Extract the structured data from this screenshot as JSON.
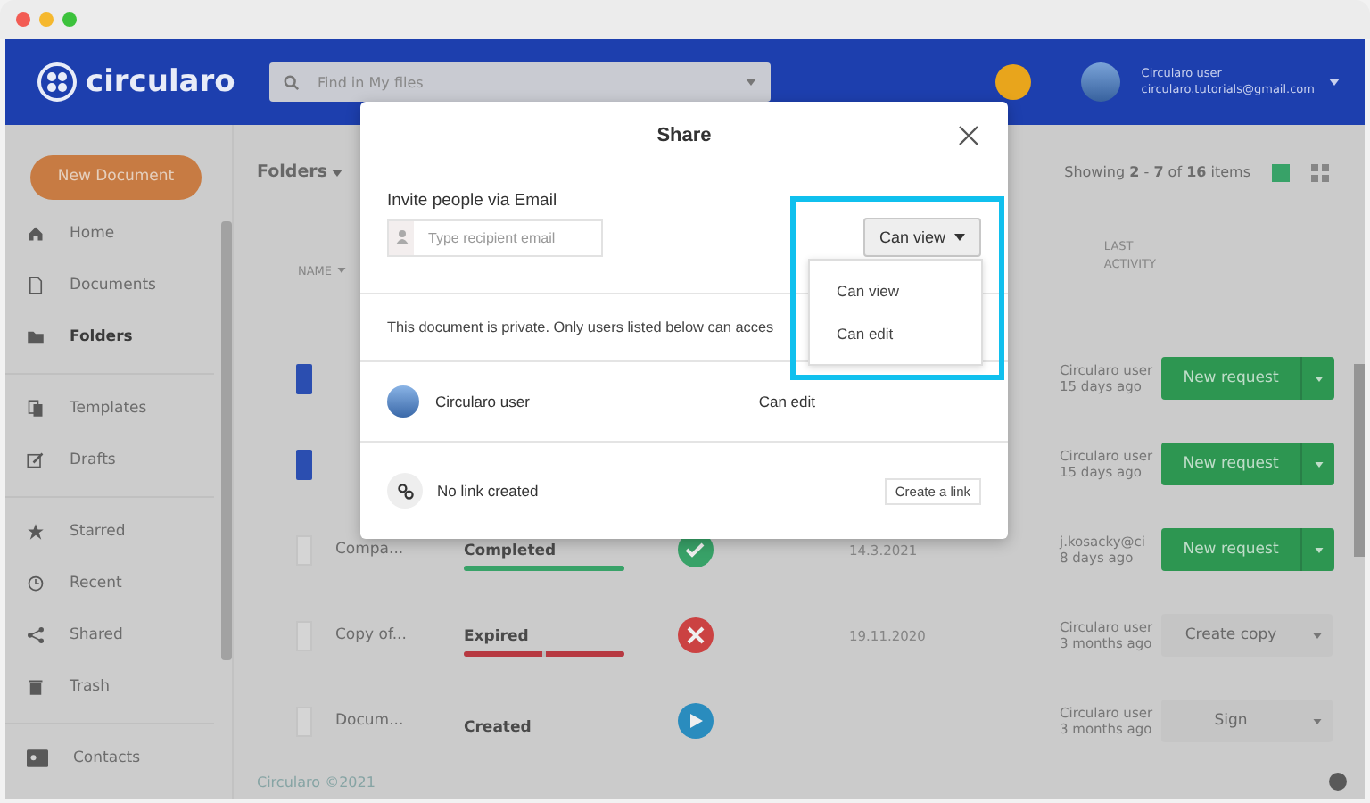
{
  "header": {
    "logo_text": "circularo",
    "search": {
      "placeholder": "Find in My files"
    },
    "user": {
      "name": "Circularo user",
      "email": "circularo.tutorials@gmail.com"
    }
  },
  "sidebar": {
    "new_document": "New Document",
    "groups": [
      [
        {
          "label": "Home",
          "selected": false
        },
        {
          "label": "Documents",
          "selected": false
        },
        {
          "label": "Folders",
          "selected": true
        }
      ],
      [
        {
          "label": "Templates",
          "selected": false
        },
        {
          "label": "Drafts",
          "selected": false
        }
      ],
      [
        {
          "label": "Starred",
          "selected": false
        },
        {
          "label": "Recent",
          "selected": false
        },
        {
          "label": "Shared",
          "selected": false
        },
        {
          "label": "Trash",
          "selected": false
        }
      ]
    ],
    "contacts": "Contacts"
  },
  "toolbar": {
    "folders_menu": "Folders",
    "showing": "Showing **2** - **7** of **16** items",
    "views": [
      {
        "selected": true
      },
      {
        "selected": false
      }
    ]
  },
  "table": {
    "name_header": "NAME",
    "activity_header": [
      "LAST",
      "ACTIVITY"
    ],
    "rows": [
      {
        "kind": "form",
        "activity_user": "Circularo user",
        "activity_time": "15 days ago",
        "action": {
          "label": "New request",
          "kind": "primary"
        }
      },
      {
        "kind": "form",
        "activity_user": "Circularo user",
        "activity_time": "15 days ago",
        "action": {
          "label": "New request",
          "kind": "primary"
        }
      },
      {
        "kind": "file",
        "name": "Compa...",
        "status": {
          "label": "Completed",
          "kind": "completed",
          "level": 1
        },
        "date": "14.3.2021",
        "activity_user": "j.kosacky@ci",
        "activity_time": "8 days ago",
        "action": {
          "label": "New request",
          "kind": "primary"
        }
      },
      {
        "kind": "file",
        "name": "Copy of...",
        "status": {
          "label": "Expired",
          "kind": "expired",
          "level": 1
        },
        "date": "19.11.2020",
        "activity_user": "Circularo user",
        "activity_time": "3 months ago",
        "action": {
          "label": "Create copy",
          "kind": "plain"
        }
      },
      {
        "kind": "file",
        "name": "Docum...",
        "status": {
          "label": "Created",
          "kind": "created"
        },
        "activity_user": "Circularo user",
        "activity_time": "3 months ago",
        "action": {
          "label": "Sign",
          "kind": "plain"
        }
      }
    ]
  },
  "footer": "Circularo ©2021",
  "modal": {
    "title": "Share",
    "invite_label": "Invite people via Email",
    "email_placeholder": "Type recipient email",
    "permission": "Can view",
    "menu_options": [
      "Can view",
      "Can edit"
    ],
    "privacy_text": "This document is private. Only users listed below can acces",
    "users": [
      {
        "name": "Circularo user",
        "permission": "Can edit"
      }
    ],
    "link": {
      "status": "No link created",
      "button": "Create a link"
    }
  }
}
